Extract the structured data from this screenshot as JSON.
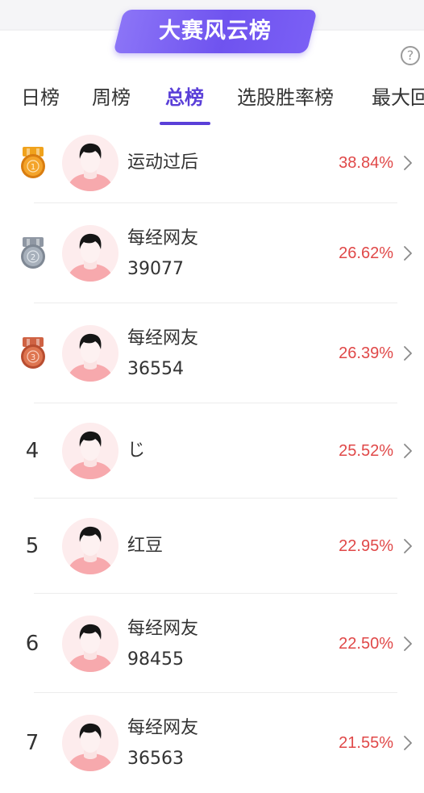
{
  "banner": {
    "title": "大赛风云榜"
  },
  "help": {
    "icon": "question-circle-icon",
    "symbol": "?"
  },
  "tabs": [
    {
      "label": "日榜",
      "active": false
    },
    {
      "label": "周榜",
      "active": false
    },
    {
      "label": "总榜",
      "active": true
    },
    {
      "label": "选股胜率榜",
      "active": false
    },
    {
      "label": "最大回",
      "active": false
    }
  ],
  "colors": {
    "accent": "#5a3fd8",
    "banner_start": "#8b74f7",
    "banner_end": "#6f53ef",
    "rate_red": "#e04848"
  },
  "ranking": [
    {
      "rank": "1",
      "medal": "gold-medal-icon",
      "name_line1": "运动过后",
      "name_line2": "",
      "rate": "38.84%"
    },
    {
      "rank": "2",
      "medal": "silver-medal-icon",
      "name_line1": "每经网友",
      "name_line2": "39077",
      "rate": "26.62%"
    },
    {
      "rank": "3",
      "medal": "bronze-medal-icon",
      "name_line1": "每经网友",
      "name_line2": "36554",
      "rate": "26.39%"
    },
    {
      "rank": "4",
      "medal": "",
      "name_line1": "じ",
      "name_line2": "",
      "rate": "25.52%"
    },
    {
      "rank": "5",
      "medal": "",
      "name_line1": "红豆",
      "name_line2": "",
      "rate": "22.95%"
    },
    {
      "rank": "6",
      "medal": "",
      "name_line1": "每经网友",
      "name_line2": "98455",
      "rate": "22.50%"
    },
    {
      "rank": "7",
      "medal": "",
      "name_line1": "每经网友",
      "name_line2": "36563",
      "rate": "21.55%"
    }
  ]
}
